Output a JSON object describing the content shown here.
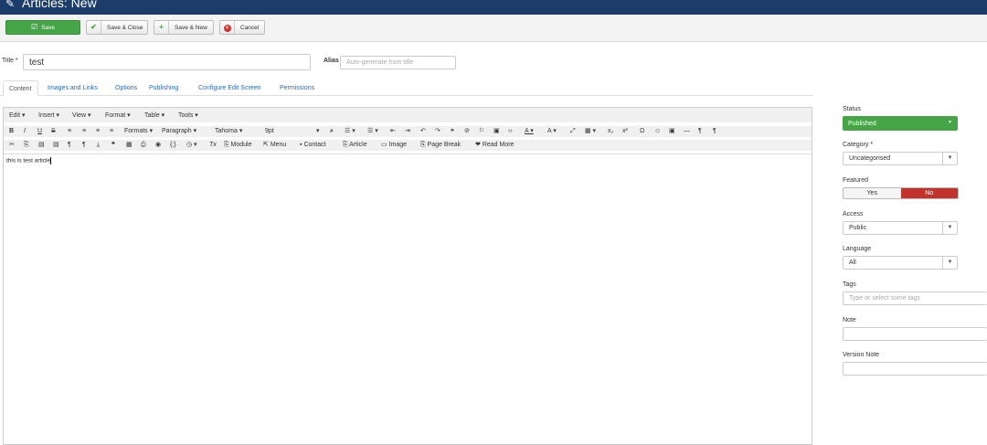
{
  "header": {
    "title": "Articles: New",
    "icon": "pencil-icon"
  },
  "toolbar": {
    "save": "Save",
    "save_close": "Save & Close",
    "save_new": "Save & New",
    "cancel": "Cancel"
  },
  "form": {
    "title_label": "Title *",
    "title_value": "test",
    "alias_label": "Alias",
    "alias_placeholder": "Auto-generate from title"
  },
  "tabs": [
    "Content",
    "Images and Links",
    "Options",
    "Publishing",
    "Configure Edit Screen",
    "Permissions"
  ],
  "editor": {
    "menus": [
      "Edit ▾",
      "Insert ▾",
      "View ▾",
      "Format ▾",
      "Table ▾",
      "Tools ▾"
    ],
    "formats": "Formats ▾",
    "paragraph": "Paragraph",
    "font": "Tahoma",
    "size": "9pt",
    "buttons": {
      "module": "Module",
      "menu": "Menu",
      "contact": "Contact",
      "article": "Article",
      "image": "Image",
      "page_break": "Page Break",
      "read_more": "Read More"
    },
    "content": "this is test article"
  },
  "sidebar": {
    "status_label": "Status",
    "status_value": "Published",
    "category_label": "Category *",
    "category_value": "Uncategorised",
    "featured_label": "Featured",
    "featured_yes": "Yes",
    "featured_no": "No",
    "access_label": "Access",
    "access_value": "Public",
    "language_label": "Language",
    "language_value": "All",
    "tags_label": "Tags",
    "tags_placeholder": "Type or select some tags",
    "note_label": "Note",
    "version_note_label": "Version Note"
  },
  "colors": {
    "header": "#1c3d6a",
    "save": "#46a546",
    "published": "#46a546",
    "no": "#c3332b",
    "link": "#2a69b8"
  }
}
